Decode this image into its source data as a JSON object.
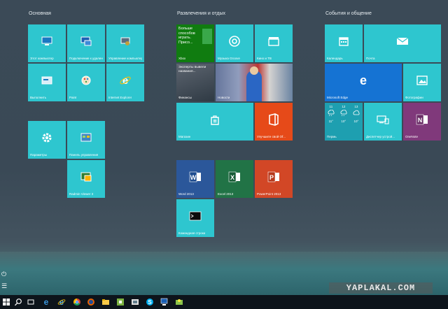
{
  "groups": {
    "main": "Основная",
    "entertainment": "Развлечения и отдых",
    "events": "События и общение"
  },
  "tiles": {
    "this_pc": "Этот компьютер",
    "network": "Подключение к удаленному...",
    "manage": "Управление компьютером",
    "run": "Выполнить",
    "paint": "Paint",
    "ie": "Internet Explorer",
    "settings": "Параметры",
    "control_panel": "Панель управления",
    "radmin": "Radmin Viewer 3",
    "xbox_text": "Больше способов играть. Присо...",
    "xbox": "Xbox",
    "groove": "Музыка Groove",
    "movies": "Кино и ТВ",
    "finance_text": "Эксперты вывели названия...",
    "finance": "Финансы",
    "news": "Новости",
    "store": "Магазин",
    "office": "Улучшите свой Of...",
    "word": "Word 2013",
    "excel": "Excel 2013",
    "powerpoint": "PowerPoint 2013",
    "cmd": "Командная строка",
    "calendar": "Календарь",
    "mail": "Почта",
    "edge": "Microsoft Edge",
    "photos": "Фотографии",
    "weather_city": "Пермь",
    "weather_days": [
      "11",
      "12",
      "13"
    ],
    "weather_temps": [
      "11°",
      "10°",
      "10°"
    ],
    "device_manager": "Диспетчер устрой...",
    "onenote": "OneNote"
  },
  "watermark": "YAPLAKAL.COM",
  "colors": {
    "tile": "#2ec6cf",
    "word": "#2b579a",
    "excel": "#217346",
    "powerpoint": "#d24726",
    "edge": "#1573d3",
    "onenote": "#80397b",
    "xbox": "#107c10"
  }
}
